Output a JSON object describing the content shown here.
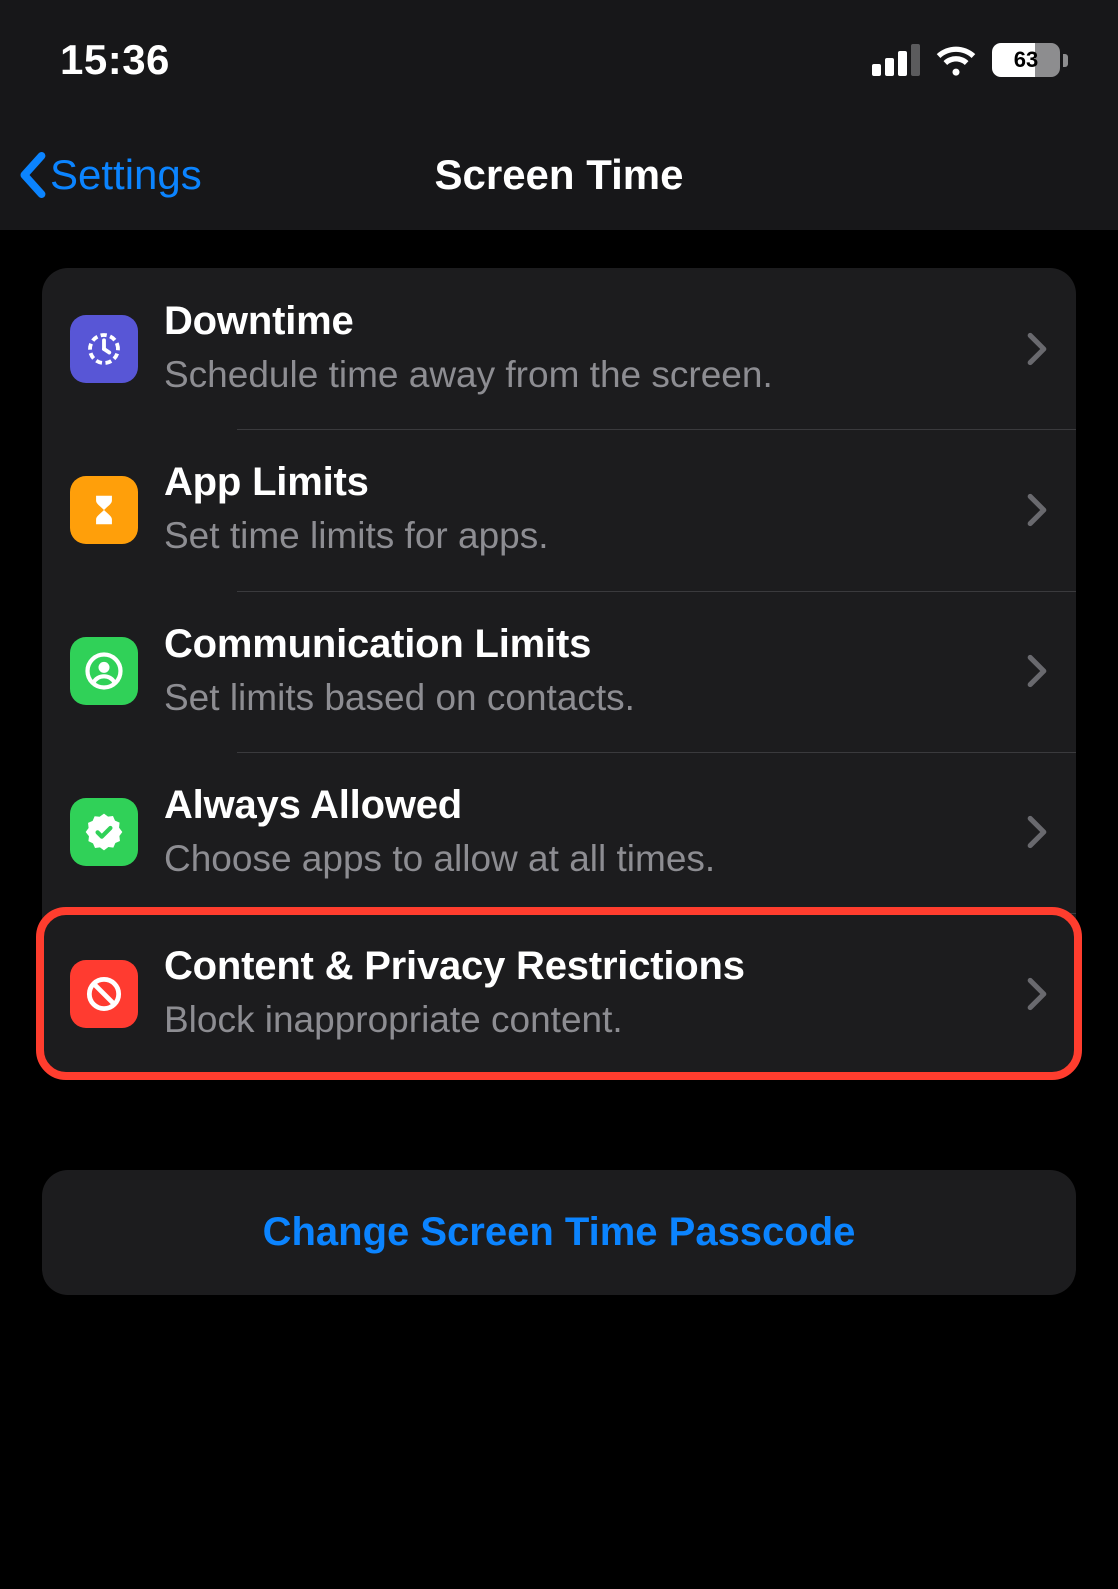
{
  "status": {
    "time": "15:36",
    "battery": "63"
  },
  "nav": {
    "back": "Settings",
    "title": "Screen Time"
  },
  "rows": [
    {
      "title": "Downtime",
      "sub": "Schedule time away from the screen.",
      "icon": "clock-icon",
      "bg": "#5856d6"
    },
    {
      "title": "App Limits",
      "sub": "Set time limits for apps.",
      "icon": "hourglass-icon",
      "bg": "#ff9f0a"
    },
    {
      "title": "Communication Limits",
      "sub": "Set limits based on contacts.",
      "icon": "person-circle-icon",
      "bg": "#30d158"
    },
    {
      "title": "Always Allowed",
      "sub": "Choose apps to allow at all times.",
      "icon": "check-badge-icon",
      "bg": "#30d158"
    },
    {
      "title": "Content & Privacy Restrictions",
      "sub": "Block inappropriate content.",
      "icon": "no-sign-icon",
      "bg": "#ff3b30",
      "highlighted": true
    }
  ],
  "passcode": {
    "label": "Change Screen Time Passcode"
  }
}
